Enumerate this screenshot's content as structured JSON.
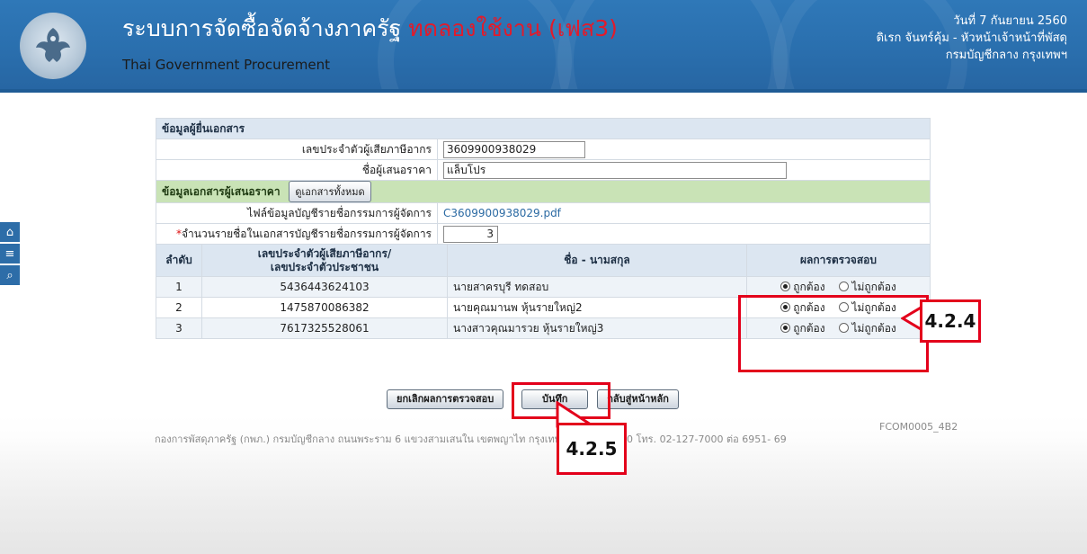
{
  "header": {
    "title_main": "ระบบการจัดซื้อจัดจ้างภาครัฐ ",
    "title_highlight": "ทดลองใช้งาน (เฟส3)",
    "subtitle": "Thai Government Procurement",
    "date": "วันที่ 7 กันยายน 2560",
    "user": "ดิเรก จันทร์คุ้ม - หัวหน้าเจ้าหน้าที่พัสดุ",
    "org": "กรมบัญชีกลาง กรุงเทพฯ",
    "logo_text": "กรมบัญชีกลาง"
  },
  "side_nav": {
    "home_icon": "⌂",
    "menu_icon": "≡",
    "search_icon": "⌕"
  },
  "submitter": {
    "section_title": "ข้อมูลผู้ยื่นเอกสาร",
    "tax_id_label": "เลขประจำตัวผู้เสียภาษีอากร",
    "tax_id_value": "3609900938029",
    "bidder_label": "ชื่อผู้เสนอราคา",
    "bidder_value": "แล็บโปร"
  },
  "documents": {
    "section_title": "ข้อมูลเอกสารผู้เสนอราคา",
    "view_all_button": "ดูเอกสารทั้งหมด",
    "file_label": "ไฟล์ข้อมูลบัญชีรายชื่อกรรมการผู้จัดการ",
    "file_link": "C3609900938029.pdf",
    "count_required": "*",
    "count_label": "จำนวนรายชื่อในเอกสารบัญชีรายชื่อกรรมการผู้จัดการ",
    "count_value": "3"
  },
  "table": {
    "col_seq": "ลำดับ",
    "col_id_1": "เลขประจำตัวผู้เสียภาษีอากร/",
    "col_id_2": "เลขประจำตัวประชาชน",
    "col_name": "ชื่อ - นามสกุล",
    "col_result": "ผลการตรวจสอบ",
    "opt_correct": "ถูกต้อง",
    "opt_incorrect": "ไม่ถูกต้อง",
    "rows": [
      {
        "seq": "1",
        "id": "5436443624103",
        "name": "นายสาครบุรี ทดสอบ"
      },
      {
        "seq": "2",
        "id": "1475870086382",
        "name": "นายคุณมานพ หุ้นรายใหญ่2"
      },
      {
        "seq": "3",
        "id": "7617325528061",
        "name": "นางสาวคุณมารวย หุ้นรายใหญ่3"
      }
    ]
  },
  "actions": {
    "cancel_check": "ยกเลิกผลการตรวจสอบ",
    "save": "บันทึก",
    "back": "กลับสู่หน้าหลัก"
  },
  "footer": {
    "text": "กองการพัสดุภาครัฐ (กพภ.) กรมบัญชีกลาง ถนนพระราม 6 แขวงสามเสนใน เขตพญาไท กรุงเทพมหานคร 10400 โทร. 02-127-7000 ต่อ 6951- 69",
    "form_code": "FCOM0005_4B2"
  },
  "annotations": {
    "a1": "4.2.4",
    "a2": "4.2.5"
  },
  "colors": {
    "header_blue": "#2f78b8",
    "highlight_red": "#e21b2b",
    "callout_red": "#e3001b"
  }
}
